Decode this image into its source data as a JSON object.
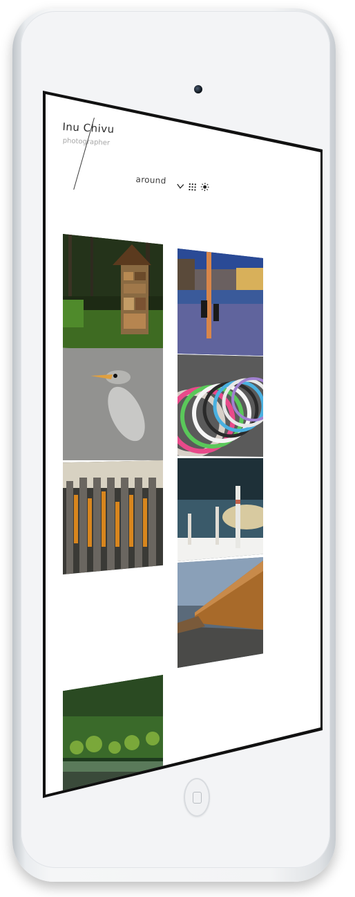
{
  "site": {
    "name": "Inu Chivu",
    "tagline": "photographer"
  },
  "nav": {
    "section_label": "around",
    "icons": [
      "chevron-down-icon",
      "grid-icon",
      "sun-icon"
    ]
  },
  "gallery": {
    "photos": [
      "insect-hotel-forest",
      "flooded-city-night",
      "heron-on-ice",
      "row-of-bicycles",
      "corn-on-fence",
      "ice-sculptures-sky",
      "wooden-wall-path",
      "forest-lake"
    ]
  },
  "colors": {
    "text": "#2c2c2c",
    "muted": "#a8a8a8",
    "device": "#f3f4f6"
  }
}
